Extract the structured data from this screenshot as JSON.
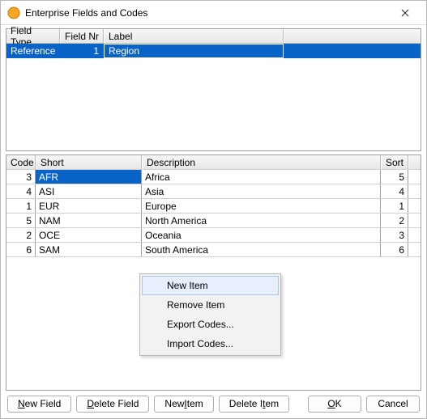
{
  "window": {
    "title": "Enterprise Fields and Codes"
  },
  "fields_grid": {
    "headers": {
      "type": "Field Type",
      "nr": "Field Nr",
      "label": "Label"
    },
    "row": {
      "type": "Reference",
      "nr": "1",
      "label": "Region"
    }
  },
  "codes_grid": {
    "headers": {
      "code": "Code",
      "short": "Short",
      "desc": "Description",
      "sort": "Sort"
    },
    "rows": [
      {
        "code": "3",
        "short": "AFR",
        "desc": "Africa",
        "sort": "5"
      },
      {
        "code": "4",
        "short": "ASI",
        "desc": "Asia",
        "sort": "4"
      },
      {
        "code": "1",
        "short": "EUR",
        "desc": "Europe",
        "sort": "1"
      },
      {
        "code": "5",
        "short": "NAM",
        "desc": "North America",
        "sort": "2"
      },
      {
        "code": "2",
        "short": "OCE",
        "desc": "Oceania",
        "sort": "3"
      },
      {
        "code": "6",
        "short": "SAM",
        "desc": "South America",
        "sort": "6"
      }
    ]
  },
  "context_menu": {
    "items": [
      "New Item",
      "Remove Item",
      "Export Codes...",
      "Import Codes..."
    ],
    "highlight_index": 0
  },
  "buttons": {
    "new_field": {
      "pre": "",
      "u": "N",
      "post": "ew Field"
    },
    "delete_field": {
      "pre": "",
      "u": "D",
      "post": "elete Field"
    },
    "new_item": {
      "pre": "New ",
      "u": "I",
      "post": "tem"
    },
    "delete_item": {
      "pre": "Delete I",
      "u": "t",
      "post": "em"
    },
    "ok": {
      "pre": "",
      "u": "O",
      "post": "K"
    },
    "cancel": {
      "pre": "Cancel",
      "u": "",
      "post": ""
    }
  }
}
